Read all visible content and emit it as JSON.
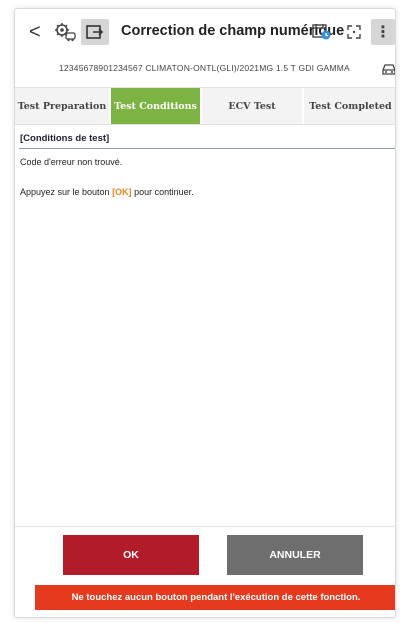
{
  "header": {
    "back_glyph": "<",
    "title": "Correction de champ numérique",
    "icons": [
      "vehicle-gear-icon",
      "screen-capture-icon",
      "calendar-icon",
      "expand-icon",
      "more-menu-icon"
    ],
    "menu_glyph": "⋮"
  },
  "vehicle": {
    "vin_line": "12345678901234567  CLIMATON-ONTL(GLI)/2021MG 1.5 T  GDI GAMMA",
    "icon": "car-icon"
  },
  "tabs": [
    {
      "label": "Test Preparation",
      "active": false
    },
    {
      "label": "Test Conditions",
      "active": true
    },
    {
      "label": "ECV Test",
      "active": false
    },
    {
      "label": "Test Completed",
      "active": false
    }
  ],
  "content": {
    "section_title": "[Conditions de test]",
    "line1": "Code d'erreur non trouvé.",
    "line2_before": "Appuyez sur le bouton ",
    "line2_highlight": "[OK]",
    "line2_after": " pour continuer."
  },
  "buttons": {
    "ok_label": "OK",
    "cancel_label": "ANNULER"
  },
  "warning": "Ne touchez aucun bouton pendant l'exécution de cette fonction.",
  "colors": {
    "active_tab": "#7cb342",
    "ok_button": "#b11b2a",
    "cancel_button": "#6e6e6e",
    "warning_bar": "#e63a1e",
    "highlight": "#e8821e"
  }
}
